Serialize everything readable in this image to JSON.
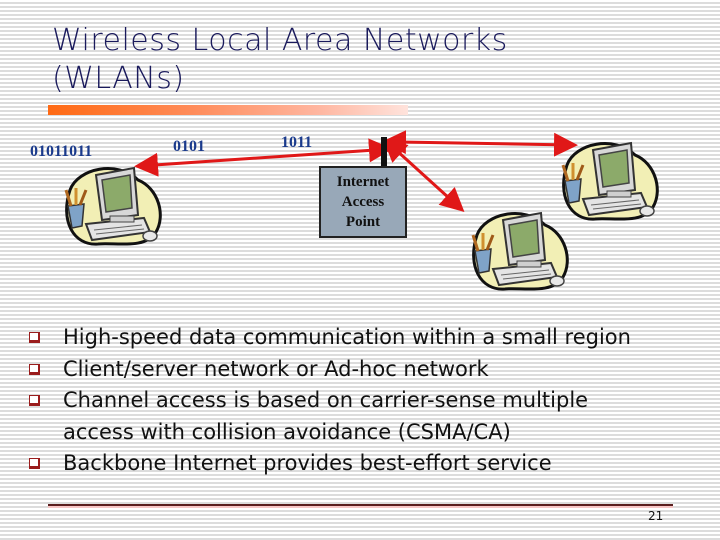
{
  "slide": {
    "title_line1": "Wireless Local Area Networks",
    "title_line2": "(WLANs)",
    "page_number": "21",
    "colors": {
      "title": "#1a1a5c",
      "bits_text": "#1a3a8c",
      "arrow": "#e01818",
      "access_point_fill": "#98a8b8",
      "bullet": "#9a1c1c",
      "title_bar_start": "#ff6a14"
    }
  },
  "diagram": {
    "bit_labels": [
      "01011011",
      "0101",
      "1011"
    ],
    "access_point": {
      "lines": [
        "Internet",
        "Access",
        "Point"
      ],
      "icon": "antenna-icon"
    },
    "computers": [
      {
        "name": "computer-left",
        "icon": "desktop-computer-icon"
      },
      {
        "name": "computer-bottom-middle",
        "icon": "desktop-computer-icon"
      },
      {
        "name": "computer-top-right",
        "icon": "desktop-computer-icon"
      }
    ]
  },
  "bullets": [
    {
      "text": "High-speed data communication within a small region"
    },
    {
      "text": "Client/server network or Ad-hoc network"
    },
    {
      "text": "Channel access is based on carrier-sense multiple access with collision avoidance (CSMA/CA)"
    },
    {
      "text": "Backbone Internet provides best-effort service"
    }
  ]
}
